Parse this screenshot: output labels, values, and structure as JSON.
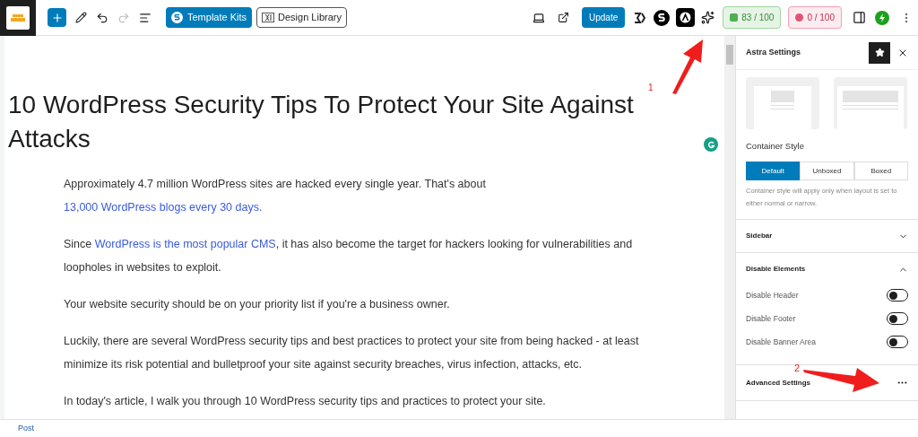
{
  "toolbar": {
    "left_buttons": [
      "Template Kits",
      "Design Library"
    ],
    "update": "Update",
    "scores": [
      {
        "text": "83 / 100",
        "kind": "good"
      },
      {
        "text": "0 / 100",
        "kind": "bad"
      }
    ]
  },
  "post": {
    "title": "10 WordPress Security Tips To Protect Your Site Against Attacks",
    "paragraphs": [
      [
        {
          "text": "Approximately 4.7 million WordPress sites are hacked every single year. That's about ",
          "link": false
        },
        {
          "text": "13,000 WordPress blogs every 30 days.",
          "link": true
        }
      ],
      [
        {
          "text": "Since ",
          "link": false
        },
        {
          "text": "WordPress is the most popular CMS",
          "link": true
        },
        {
          "text": ", it has also become the target for hackers looking for vulnerabilities and loopholes in websites to exploit.",
          "link": false
        }
      ],
      [
        {
          "text": "Your website security should be on your priority list if you're a business owner.",
          "link": false
        }
      ],
      [
        {
          "text": "Luckily, there are several WordPress security tips and best practices to protect your site from being hacked - at least minimize its risk potential and bulletproof your site against security breaches, virus infection, attacks, etc.",
          "link": false
        }
      ],
      [
        {
          "text": "In today's article, I walk you through 10 WordPress security tips and practices to protect your site.",
          "link": false
        }
      ]
    ]
  },
  "sidebar": {
    "title": "Astra Settings",
    "container_style": {
      "label": "Container Style",
      "options": [
        {
          "label": "Default",
          "selected": true
        },
        {
          "label": "Unboxed",
          "selected": false
        },
        {
          "label": "Boxed",
          "selected": false
        }
      ],
      "help": "Container style will apply only when layout is set to either normal or narrow."
    },
    "sections": [
      {
        "title": "Sidebar",
        "expanded": false
      },
      {
        "title": "Disable Elements",
        "expanded": true
      }
    ],
    "toggles": [
      {
        "label": "Disable Header",
        "on": false
      },
      {
        "label": "Disable Footer",
        "on": false
      },
      {
        "label": "Disable Banner Area",
        "on": false
      }
    ],
    "advanced": "Advanced Settings"
  },
  "annotations": [
    "1",
    "2"
  ],
  "footer": "Post"
}
